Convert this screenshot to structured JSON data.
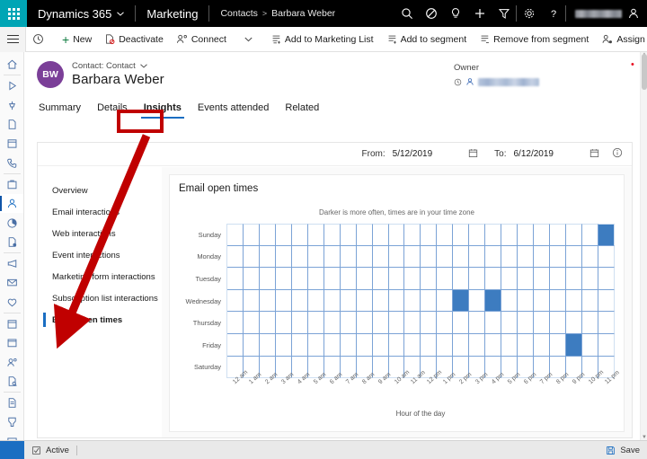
{
  "topbar": {
    "waffle": "app-launcher",
    "brand": "Dynamics 365",
    "app": "Marketing",
    "breadcrumb_parent": "Contacts",
    "breadcrumb_sep": ">",
    "breadcrumb_current": "Barbara Weber",
    "icons": [
      "search-icon",
      "check-circle-icon",
      "lightbulb-icon",
      "plus-icon",
      "filter-icon",
      "gear-icon",
      "help-icon",
      "person-icon"
    ]
  },
  "commandbar": {
    "new": "New",
    "deactivate": "Deactivate",
    "connect": "Connect",
    "add_to_marketing_list": "Add to Marketing List",
    "add_to_segment": "Add to segment",
    "remove_from_segment": "Remove from segment",
    "assign": "Assign",
    "overflow": "···"
  },
  "record": {
    "avatar_initials": "BW",
    "type_label": "Contact: Contact",
    "name": "Barbara Weber",
    "owner_label": "Owner",
    "owner_value": ""
  },
  "tabs": [
    {
      "label": "Summary",
      "active": false
    },
    {
      "label": "Details",
      "active": false
    },
    {
      "label": "Insights",
      "active": true
    },
    {
      "label": "Events attended",
      "active": false
    },
    {
      "label": "Related",
      "active": false
    }
  ],
  "daterange": {
    "from_label": "From:",
    "from_value": "5/12/2019",
    "to_label": "To:",
    "to_value": "6/12/2019"
  },
  "insights_nav": [
    {
      "label": "Overview",
      "active": false
    },
    {
      "label": "Email interactions",
      "active": false
    },
    {
      "label": "Web interactions",
      "active": false
    },
    {
      "label": "Event interactions",
      "active": false
    },
    {
      "label": "Marketing form interactions",
      "active": false
    },
    {
      "label": "Subscription list interactions",
      "active": false
    },
    {
      "label": "Email open times",
      "active": true
    }
  ],
  "statusbar": {
    "state": "Active",
    "save": "Save"
  },
  "colors": {
    "accent": "#1b6ec2",
    "waffle": "#00a5b5",
    "avatar": "#7b3f98",
    "heat_fill": "#3d7cc0",
    "heat_grid": "#7ba3d6",
    "annotation": "#c00000",
    "new_plus": "#107c41"
  },
  "chart_data": {
    "type": "heatmap",
    "title": "Email open times",
    "subtitle": "Darker is more often, times are in your time zone",
    "xlabel": "Hour of the day",
    "ylabel": "",
    "categories_y": [
      "Sunday",
      "Monday",
      "Tuesday",
      "Wednesday",
      "Thursday",
      "Friday",
      "Saturday"
    ],
    "categories_x": [
      "12 am",
      "1 am",
      "2 am",
      "3 am",
      "4 am",
      "5 am",
      "6 am",
      "7 am",
      "8 am",
      "9 am",
      "10 am",
      "11 am",
      "12 pm",
      "1 pm",
      "2 pm",
      "3 pm",
      "4 pm",
      "5 pm",
      "6 pm",
      "7 pm",
      "8 pm",
      "9 pm",
      "10 pm",
      "11 pm"
    ],
    "grid": true,
    "legend": "none",
    "values": [
      [
        0,
        0,
        0,
        0,
        0,
        0,
        0,
        0,
        0,
        0,
        0,
        0,
        0,
        0,
        0,
        0,
        0,
        0,
        0,
        0,
        0,
        0,
        0,
        1
      ],
      [
        0,
        0,
        0,
        0,
        0,
        0,
        0,
        0,
        0,
        0,
        0,
        0,
        0,
        0,
        0,
        0,
        0,
        0,
        0,
        0,
        0,
        0,
        0,
        0
      ],
      [
        0,
        0,
        0,
        0,
        0,
        0,
        0,
        0,
        0,
        0,
        0,
        0,
        0,
        0,
        0,
        0,
        0,
        0,
        0,
        0,
        0,
        0,
        0,
        0
      ],
      [
        0,
        0,
        0,
        0,
        0,
        0,
        0,
        0,
        0,
        0,
        0,
        0,
        0,
        0,
        1,
        0,
        1,
        0,
        0,
        0,
        0,
        0,
        0,
        0
      ],
      [
        0,
        0,
        0,
        0,
        0,
        0,
        0,
        0,
        0,
        0,
        0,
        0,
        0,
        0,
        0,
        0,
        0,
        0,
        0,
        0,
        0,
        0,
        0,
        0
      ],
      [
        0,
        0,
        0,
        0,
        0,
        0,
        0,
        0,
        0,
        0,
        0,
        0,
        0,
        0,
        0,
        0,
        0,
        0,
        0,
        0,
        0,
        1,
        0,
        0
      ],
      [
        0,
        0,
        0,
        0,
        0,
        0,
        0,
        0,
        0,
        0,
        0,
        0,
        0,
        0,
        0,
        0,
        0,
        0,
        0,
        0,
        0,
        0,
        0,
        0
      ]
    ]
  }
}
